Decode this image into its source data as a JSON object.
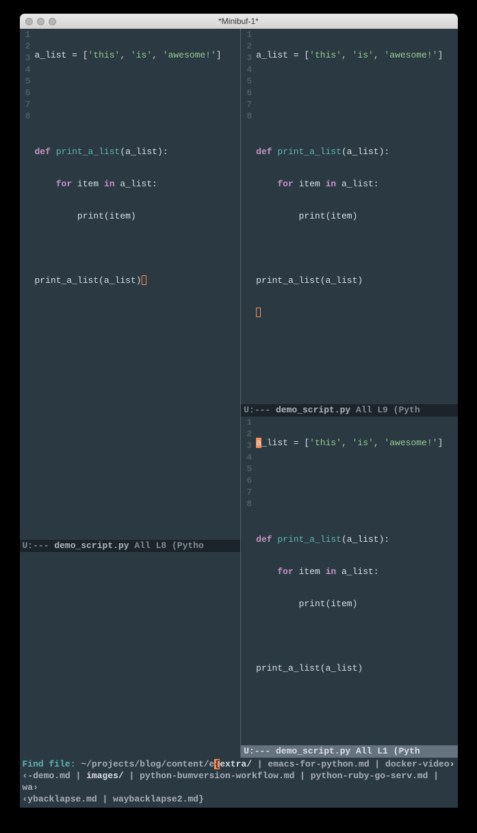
{
  "window": {
    "title": "*Minibuf-1*"
  },
  "panes": {
    "left": {
      "lines": [
        1,
        2,
        3,
        4,
        5,
        6,
        7,
        8
      ],
      "modeline": {
        "state": "U:---",
        "fname": "demo_script.py",
        "pos": "All L8",
        "mode": "(Pytho"
      }
    },
    "right_top": {
      "lines": [
        1,
        2,
        3,
        4,
        5,
        6,
        7,
        8
      ],
      "modeline": {
        "state": "U:---",
        "fname": "demo_script.py",
        "pos": "All L9",
        "mode": "(Pyth"
      }
    },
    "right_bot": {
      "lines": [
        1,
        2,
        3,
        4,
        5,
        6,
        7,
        8
      ],
      "modeline": {
        "state": "U:---",
        "fname": "demo_script.py",
        "pos": "All L1",
        "mode": "(Pyth"
      }
    }
  },
  "source": {
    "l1a": "a_list = [",
    "s1": "'this'",
    "s2": "'is'",
    "s3": "'awesome!'",
    "l1b": "]",
    "def": "def",
    "fn": "print_a_list",
    "sigopen": "(a_list):",
    "for": "for",
    "foritem": " item ",
    "in": "in",
    "fortail": " a_list:",
    "printcall": "print(item)",
    "lastcall": "print_a_list(a_list)",
    "comma": ", ",
    "indent1": "    ",
    "indent2": "        "
  },
  "minibuf": {
    "prompt": "Find file: ",
    "path": "~/projects/blog/content/e",
    "highlight": "{",
    "sel": "extra/",
    "rest1": " | emacs-for-python.md | docker-video",
    "cont1": "‹-demo.md | ",
    "images": "images/",
    "rest2": " | python-bumversion-workflow.md | python-ruby-go-serv.md | wa›",
    "cont2": "‹ybacklapse.md | waybacklapse2.md}"
  }
}
